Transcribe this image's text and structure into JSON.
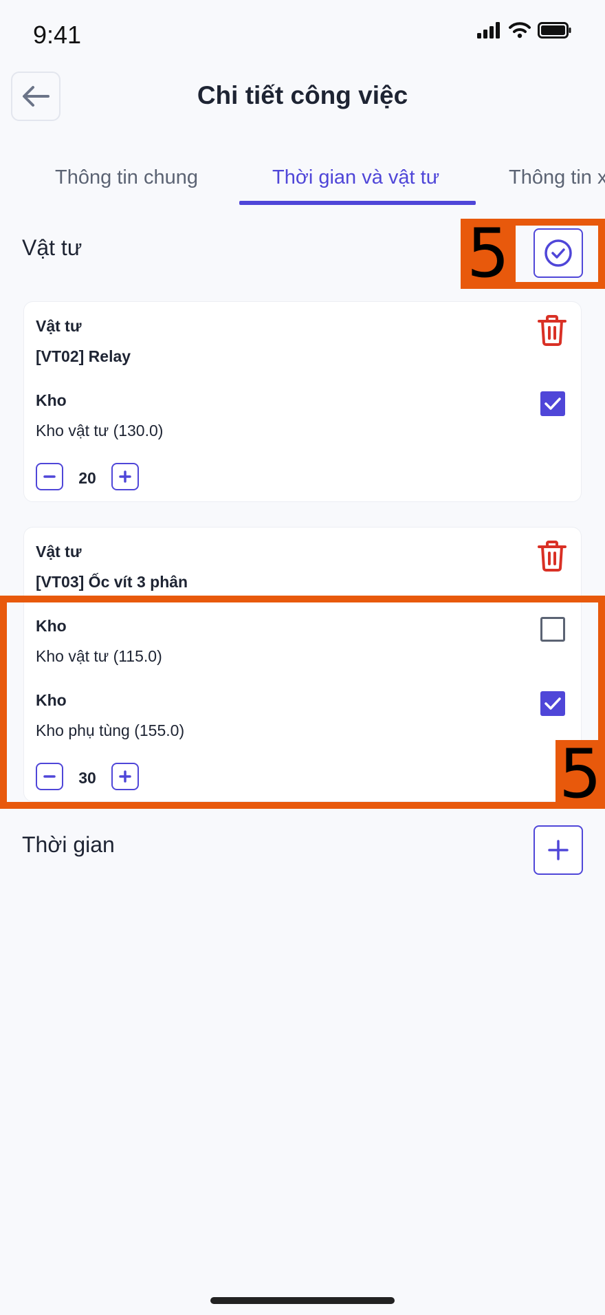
{
  "status_bar": {
    "time": "9:41"
  },
  "header": {
    "title": "Chi tiết công việc"
  },
  "tabs": [
    {
      "label": "Thông tin chung"
    },
    {
      "label": "Thời gian và vật tư"
    },
    {
      "label": "Thông tin x"
    }
  ],
  "materials_section": {
    "title": "Vật tư"
  },
  "cards": [
    {
      "material_label": "Vật tư",
      "material_value": "[VT02] Relay",
      "warehouses": [
        {
          "label": "Kho",
          "value": "Kho vật tư (130.0)",
          "checked": true
        }
      ],
      "quantity": "20"
    },
    {
      "material_label": "Vật tư",
      "material_value": "[VT03] Ốc vít 3 phân",
      "warehouses": [
        {
          "label": "Kho",
          "value": "Kho vật tư (115.0)",
          "checked": false
        },
        {
          "label": "Kho",
          "value": "Kho phụ tùng (155.0)",
          "checked": true
        }
      ],
      "quantity": "30"
    }
  ],
  "time_section": {
    "title": "Thời gian"
  },
  "annotations": [
    {
      "label": "5"
    },
    {
      "label": "5"
    }
  ],
  "colors": {
    "accent": "#4f46d8",
    "danger": "#d93025",
    "annotation": "#e8590c"
  }
}
